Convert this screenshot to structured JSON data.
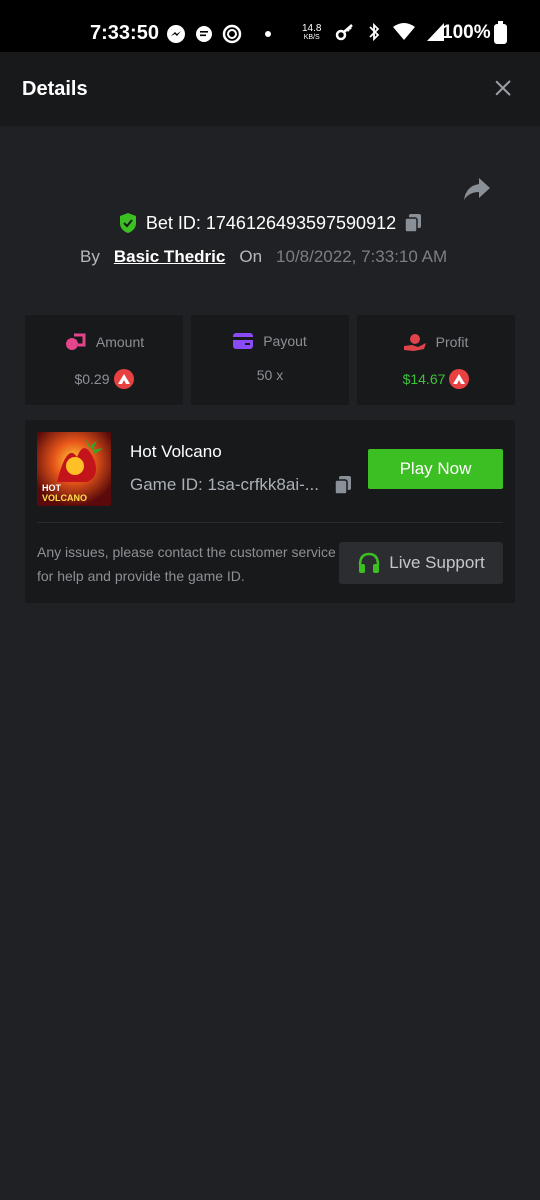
{
  "status_bar": {
    "time": "7:33:50",
    "net_speed_value": "14.8",
    "net_speed_unit": "KB/S",
    "battery": "100%"
  },
  "header": {
    "title": "Details"
  },
  "bet": {
    "id_label": "Bet ID: 1746126493597590912",
    "by_label": "By",
    "user": "Basic Thedric",
    "on_label": "On",
    "date": "10/8/2022, 7:33:10 AM"
  },
  "stats": {
    "amount_label": "Amount",
    "amount_value": "$0.29",
    "payout_label": "Payout",
    "payout_value": "50 x",
    "profit_label": "Profit",
    "profit_value": "$14.67"
  },
  "game": {
    "name": "Hot Volcano",
    "game_id": "Game ID: 1sa-crfkk8ai-...",
    "thumb_text_1": "HOT",
    "thumb_text_2": "VOLCANO",
    "play_label": "Play Now",
    "help_text": "Any issues, please contact the customer service for help and provide the game ID.",
    "support_label": "Live Support"
  },
  "colors": {
    "accent_green": "#3cbf22",
    "profit_green": "#3ec23a",
    "avax_red": "#e84142",
    "background": "#202124",
    "card": "#18191b"
  },
  "icons": [
    "messenger-icon",
    "chat-icon",
    "spinner-icon",
    "key-icon",
    "bluetooth-icon",
    "wifi-icon",
    "signal-icon",
    "battery-icon",
    "close-icon",
    "share-icon",
    "shield-check-icon",
    "copy-icon",
    "amount-icon",
    "payout-card-icon",
    "profit-hand-icon",
    "avax-icon",
    "headset-icon"
  ]
}
